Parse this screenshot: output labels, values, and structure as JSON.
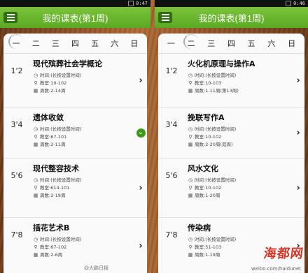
{
  "screens": [
    {
      "status_time": "0:47",
      "title": "我的课表(第1周)",
      "days": [
        "一",
        "二",
        "三",
        "四",
        "五",
        "六",
        "日"
      ],
      "active_day": 0,
      "slots": [
        {
          "num": "1'2",
          "name": "现代殡葬社会学概论",
          "time": "时间:(长按设置时间)",
          "room": "教室:10-102",
          "weeks": "周数:2-14周",
          "chevron": "plain"
        },
        {
          "num": "3'4",
          "name": "遗体收敛",
          "time": "时间:(长按设置时间)",
          "room": "教室:67-101",
          "weeks": "周数:2-11周",
          "chevron": "green"
        },
        {
          "num": "5'6",
          "name": "现代整容技术",
          "time": "时间:(长按设置时间)",
          "room": "教室:614-101",
          "weeks": "周数:2-19周",
          "chevron": "plain"
        },
        {
          "num": "7'8",
          "name": "插花艺术B",
          "time": "时间:(长按设置时间)",
          "room": "教室:67-102",
          "weeks": "周数:2-6周",
          "chevron": "plain"
        }
      ]
    },
    {
      "status_time": "0:46",
      "title": "我的课表(第1周)",
      "days": [
        "一",
        "二",
        "三",
        "四",
        "五",
        "六",
        "日"
      ],
      "active_day": 1,
      "slots": [
        {
          "num": "1'2",
          "name": "火化机原理与操作A",
          "time": "时间:(长按设置时间)",
          "room": "教室:10-103",
          "weeks": "周数:1-11周(第13周)",
          "chevron": "plain"
        },
        {
          "num": "3'4",
          "name": "挽联写作A",
          "time": "时间:(长按设置时间)",
          "room": "教室:10-102",
          "weeks": "周数:2-20周(双周)",
          "chevron": "plain"
        },
        {
          "num": "5'6",
          "name": "风水文化",
          "time": "时间:(长按设置时间)",
          "room": "教室:10-102",
          "weeks": "周数:1-20周",
          "chevron": "plain"
        },
        {
          "num": "7'8",
          "name": "传染病",
          "time": "时间:(长按设置时间)",
          "room": "教室:51-103",
          "weeks": "周数:1-19周",
          "chevron": "plain"
        }
      ]
    }
  ],
  "watermark": {
    "logo": "海都网",
    "weibo": "@大鹏日报",
    "url": "weibo.com/haidunet"
  },
  "icons": {
    "menu": "menu-icon",
    "time": "clock-icon",
    "room": "pin-icon",
    "weeks": "calendar-icon",
    "chevron": "chevron-right-icon"
  },
  "colors": {
    "accent": "#5aa823",
    "menu_btn": "#2f6e0f",
    "watermark": "#d42b1c"
  }
}
